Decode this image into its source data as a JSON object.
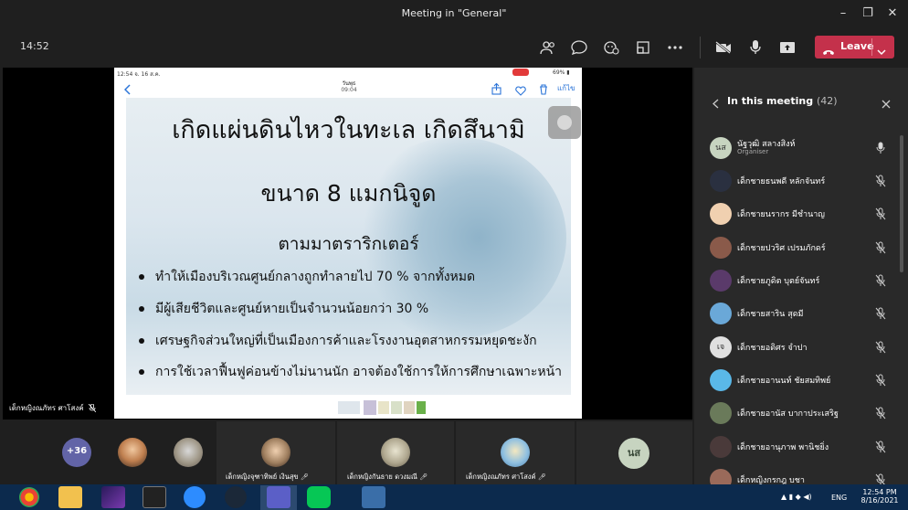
{
  "window": {
    "title": "Meeting in \"General\"",
    "minimize": "–",
    "maximize": "❐",
    "close": "✕"
  },
  "toolbar": {
    "clock": "14:52",
    "leave_label": "Leave"
  },
  "phone": {
    "status_left": "12:54  จ. 16 ส.ค.",
    "status_right": "69% ▮",
    "nav_title": "วันพุธ",
    "nav_time": "09:04",
    "edit_label": "แก้ไข"
  },
  "slide": {
    "title": "เกิดแผ่นดินไหวในทะเล  เกิดสึนามิ",
    "subtitle": "ขนาด 8 แมกนิจูด",
    "subtitle2": "ตามมาตราริกเตอร์",
    "bullets": [
      "ทำให้เมืองบริเวณศูนย์กลางถูกทำลายไป 70 % จากทั้งหมด",
      "มีผู้เสียชีวิตและศูนย์หายเป็นจำนวนน้อยกว่า 30 %",
      "เศรษฐกิจส่วนใหญ่ที่เป็นเมืองการค้าและโรงงานอุตสาหกรรมหยุดชะงัก",
      "การใช้เวลาฟื้นฟูค่อนข้างไม่นานนัก  อาจต้องใช้การให้การศึกษาเฉพาะหน้า"
    ]
  },
  "presenter": {
    "name": "เด็กหญิงณภัทร ศาโสงค์"
  },
  "panel": {
    "title": "In this meeting",
    "count": "(42)"
  },
  "participants": [
    {
      "name": "นัฐวุฒิ สลางสิงห์",
      "role": "Organiser",
      "initials": "นส",
      "color": "#c7d4c0"
    },
    {
      "name": "เด็กชายธนพดี หลักจันทร์",
      "role": "",
      "initials": "",
      "color": "#2a3040"
    },
    {
      "name": "เด็กชายนรากร มีชำนาญ",
      "role": "",
      "initials": "",
      "color": "#f0d0b0"
    },
    {
      "name": "เด็กชายปวริศ เปรมภักดร์",
      "role": "",
      "initials": "",
      "color": "#8a5a4a"
    },
    {
      "name": "เด็กชายภูดิต บุตย์จันทร์",
      "role": "",
      "initials": "",
      "color": "#5a3a6a"
    },
    {
      "name": "เด็กชายสาริน สุดมี",
      "role": "",
      "initials": "",
      "color": "#6aa8d8"
    },
    {
      "name": "เด็กชายอดิศร จำปา",
      "role": "",
      "initials": "เจ",
      "color": "#e0e0e0"
    },
    {
      "name": "เด็กชายอานนท์ ชัยสมทิพย์",
      "role": "",
      "initials": "",
      "color": "#5ab8e8"
    },
    {
      "name": "เด็กชายอานัส บากาประเสริฐ",
      "role": "",
      "initials": "",
      "color": "#6a7a5a"
    },
    {
      "name": "เด็กชายอานุภาพ พานิชยิ่ง",
      "role": "",
      "initials": "",
      "color": "#4a3a3a"
    },
    {
      "name": "เด็กหญิงกรกฎ บชา",
      "role": "",
      "initials": "",
      "color": "#9a6a5a"
    }
  ],
  "bottom": {
    "more_count": "+36",
    "tiles": [
      {
        "name": "เด็กหญิงจุฑาทิพย์ เงินสุข"
      },
      {
        "name": "เด็กหญิงกันธาย ดวงมณี"
      },
      {
        "name": "เด็กหญิงณภัทร ศาโสงค์"
      }
    ],
    "initials_tile": "นส"
  },
  "taskbar": {
    "lang": "ENG",
    "time": "12:54 PM",
    "date": "8/16/2021"
  },
  "colors": {
    "leave": "#c4314b",
    "taskbar": "#0c2a4d",
    "panel": "#292929"
  }
}
